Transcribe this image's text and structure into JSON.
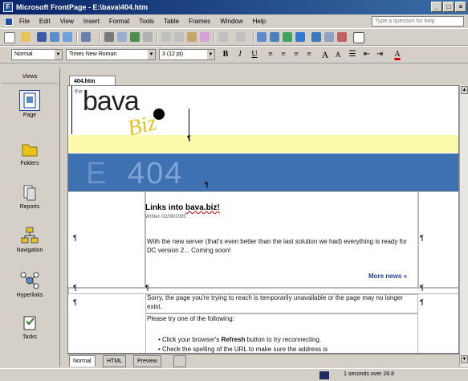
{
  "window": {
    "title": "Microsoft FrontPage - E:\\bava\\404.htm",
    "app_icon": "frontpage-icon"
  },
  "menu": {
    "items": [
      "File",
      "Edit",
      "View",
      "Insert",
      "Format",
      "Tools",
      "Table",
      "Frames",
      "Window",
      "Help"
    ],
    "help_placeholder": "Type a question for help"
  },
  "formatting": {
    "style": "Normal",
    "font": "Times New Roman",
    "size": "3 (12 pt)"
  },
  "views": {
    "header": "Views",
    "items": [
      "Page",
      "Folders",
      "Reports",
      "Navigation",
      "Hyperlinks",
      "Tasks"
    ]
  },
  "document": {
    "tab_label": "404.htm",
    "logo_the": "the",
    "logo_bava": "bava",
    "logo_biz": "Biz",
    "banner_text": "404",
    "banner_letter": "E",
    "news_title_prefix": "Links into ",
    "news_title_link": "bava.biz!",
    "news_date": "Written 02/08/2005",
    "news_body": "With the new server (that's even better than the last solution we had) everything is ready for DC version 2... Coming soon!",
    "more_news": "More news »",
    "sorry_text": "Sorry, the page you're trying to reach is temporarily unavailable or the page may no longer exist.",
    "please_try": "Please try one of the following:",
    "bullet1_pre": "Click your browser's ",
    "bullet1_bold": "Refresh",
    "bullet1_post": " button to try reconnecting.",
    "bullet2": "Check the spelling of the URL to make sure the address is"
  },
  "bottom_tabs": [
    "Normal",
    "HTML",
    "Preview"
  ],
  "status": {
    "text": "1 seconds over 28.8"
  },
  "colors": {
    "titlebar": "#0a246a",
    "banner_blue": "#3d71b1",
    "banner_yellow": "#fbf9aa",
    "logo_yellow": "#e8c41a",
    "link_blue": "#1f3ea8"
  }
}
